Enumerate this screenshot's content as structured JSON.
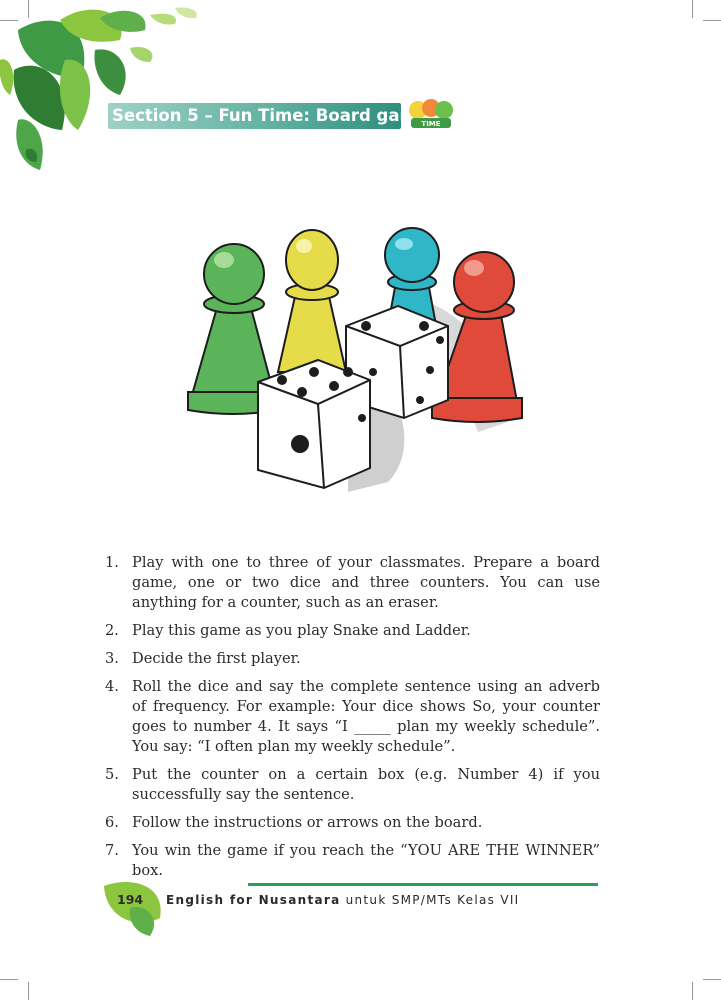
{
  "header": {
    "section_label": "Section 5 – Fun Time: ",
    "section_topic": "Board game",
    "badge_icon": "fun-time-badge"
  },
  "illustration": {
    "pawn_colors": [
      "#5bb35a",
      "#e6dc4a",
      "#2fb7c7",
      "#e04a3b"
    ],
    "dice_color": "#ffffff"
  },
  "rules": [
    {
      "num": "1.",
      "text": "Play with one to three of your classmates. Prepare a board game, one or two dice and three counters. You can use anything for a counter, such as an eraser."
    },
    {
      "num": "2.",
      "text": "Play this game as you play Snake and Ladder."
    },
    {
      "num": "3.",
      "text": "Decide the first player."
    },
    {
      "num": "4.",
      "text": "Roll the dice and say the complete sentence using an adverb of frequency. For example: Your dice shows So, your counter goes to number 4. It says “I _____ plan my weekly schedule”. You say: “I often plan my weekly schedule”."
    },
    {
      "num": "5.",
      "text": "Put the counter on a certain box (e.g. Number 4) if you successfully say the sentence."
    },
    {
      "num": "6.",
      "text": "Follow the instructions or arrows on the board."
    },
    {
      "num": "7.",
      "text": "You win the game if you reach the “YOU ARE THE WINNER” box."
    }
  ],
  "footer": {
    "page_number": "194",
    "book_title": "English for Nusantara",
    "book_subtitle": " untuk SMP/MTs Kelas VII",
    "accent_color": "#2f9e5a"
  }
}
